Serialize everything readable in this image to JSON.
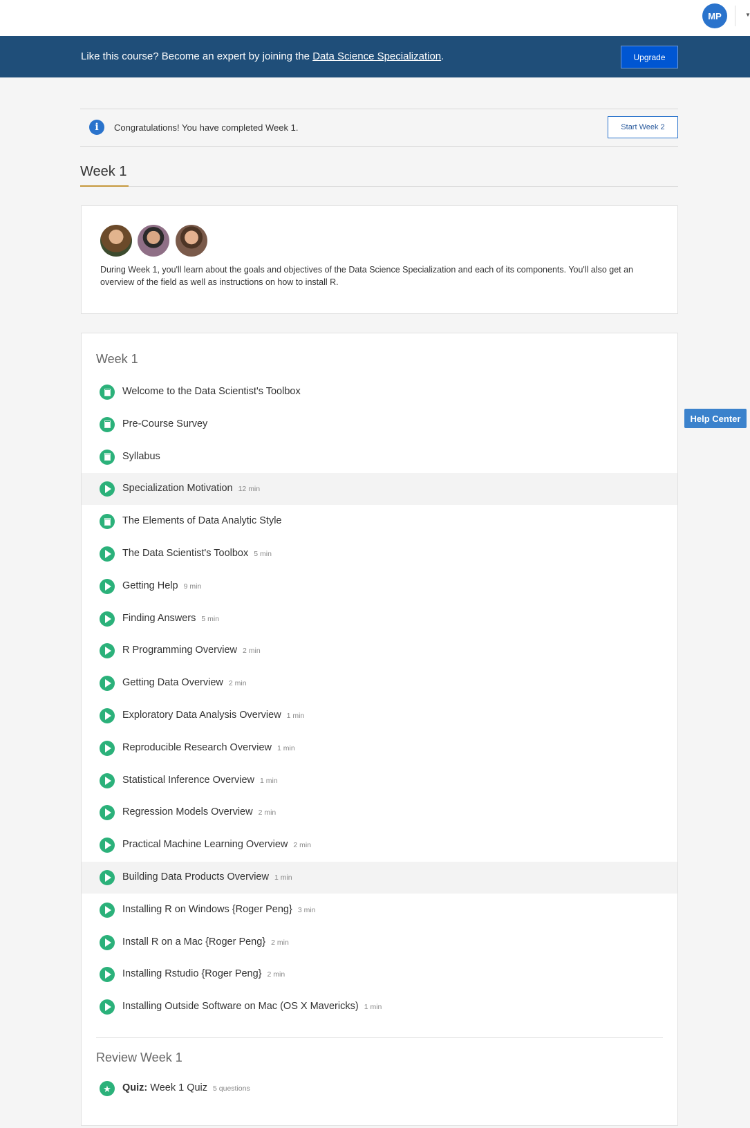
{
  "header": {
    "user_initials": "MP"
  },
  "banner": {
    "text_before": "Like this course? Become an expert by joining the ",
    "link_text": "Data Science Specialization",
    "text_after": ".",
    "upgrade_label": "Upgrade"
  },
  "notice": {
    "icon": "info-icon",
    "message": "Congratulations! You have completed Week 1.",
    "button_label": "Start Week 2"
  },
  "week": {
    "title": "Week 1",
    "description": "During Week 1, you'll learn about the goals and objectives of the Data Science Specialization and each of its components. You'll also get an overview of the field as well as instructions on how to install R."
  },
  "lessons_section": {
    "title": "Week 1",
    "items": [
      {
        "type": "reading",
        "name": "Welcome to the Data Scientist's Toolbox",
        "duration": ""
      },
      {
        "type": "reading",
        "name": "Pre-Course Survey",
        "duration": ""
      },
      {
        "type": "reading",
        "name": "Syllabus",
        "duration": ""
      },
      {
        "type": "video",
        "name": "Specialization Motivation",
        "duration": "12 min"
      },
      {
        "type": "reading",
        "name": "The Elements of Data Analytic Style",
        "duration": ""
      },
      {
        "type": "video",
        "name": "The Data Scientist's Toolbox",
        "duration": "5 min"
      },
      {
        "type": "video",
        "name": "Getting Help",
        "duration": "9 min"
      },
      {
        "type": "video",
        "name": "Finding Answers",
        "duration": "5 min"
      },
      {
        "type": "video",
        "name": "R Programming Overview",
        "duration": "2 min"
      },
      {
        "type": "video",
        "name": "Getting Data Overview",
        "duration": "2 min"
      },
      {
        "type": "video",
        "name": "Exploratory Data Analysis Overview",
        "duration": "1 min"
      },
      {
        "type": "video",
        "name": "Reproducible Research Overview",
        "duration": "1 min"
      },
      {
        "type": "video",
        "name": "Statistical Inference Overview",
        "duration": "1 min"
      },
      {
        "type": "video",
        "name": "Regression Models Overview",
        "duration": "2 min"
      },
      {
        "type": "video",
        "name": "Practical Machine Learning Overview",
        "duration": "2 min"
      },
      {
        "type": "video",
        "name": "Building Data Products Overview",
        "duration": "1 min"
      },
      {
        "type": "video",
        "name": "Installing R on Windows {Roger Peng}",
        "duration": "3 min"
      },
      {
        "type": "video",
        "name": "Install R on a Mac {Roger Peng}",
        "duration": "2 min"
      },
      {
        "type": "video",
        "name": "Installing Rstudio {Roger Peng}",
        "duration": "2 min"
      },
      {
        "type": "video",
        "name": "Installing Outside Software on Mac (OS X Mavericks)",
        "duration": "1 min"
      }
    ]
  },
  "review_section": {
    "title": "Review Week 1",
    "quiz_label": "Quiz:",
    "quiz_name": "Week 1 Quiz",
    "quiz_meta": "5 questions"
  },
  "help": {
    "label": "Help Center"
  },
  "colors": {
    "banner": "#1f4e79",
    "accent": "#0056d2",
    "success": "#2bb17a",
    "tab_underline": "#c5983c"
  }
}
